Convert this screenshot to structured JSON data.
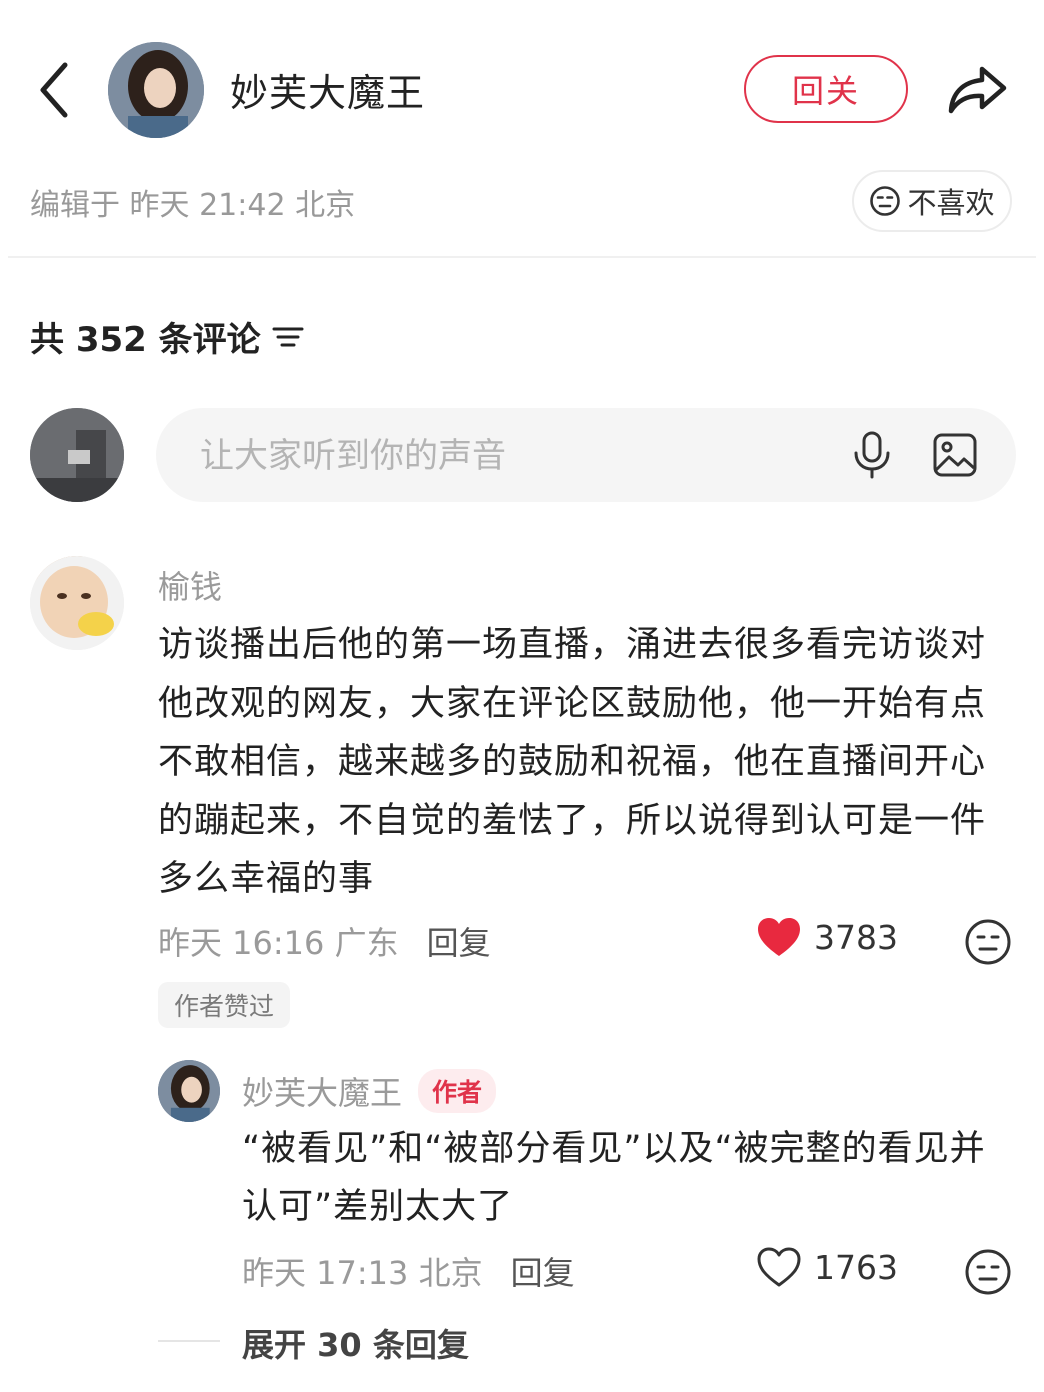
{
  "header": {
    "author_name": "妙芙大魔王",
    "follow_label": "回关"
  },
  "post_meta": {
    "edit_info": "编辑于 昨天 21:42 北京",
    "dislike_label": "不喜欢"
  },
  "comments_header": {
    "count_text": "共 352 条评论"
  },
  "comment_input": {
    "placeholder": "让大家听到你的声音"
  },
  "comments": [
    {
      "username": "榆钱",
      "text": "访谈播出后他的第一场直播，涌进去很多看完访谈对他改观的网友，大家在评论区鼓励他，他一开始有点不敢相信，越来越多的鼓励和祝福，他在直播间开心的蹦起来，不自觉的羞怯了，所以说得到认可是一件多么幸福的事",
      "time": "昨天 16:16",
      "location": "广东",
      "reply_label": "回复",
      "likes": "3783",
      "liked": true,
      "author_liked_label": "作者赞过",
      "replies": [
        {
          "username": "妙芙大魔王",
          "badge": "作者",
          "text": "“被看见”和“被部分看见”以及“被完整的看见并认可”差别太大了",
          "time": "昨天 17:13",
          "location": "北京",
          "reply_label": "回复",
          "likes": "1763",
          "liked": false
        }
      ],
      "expand_label": "展开 30 条回复"
    }
  ],
  "colors": {
    "accent": "#e0334a",
    "muted_text": "#9a9a9a",
    "input_bg": "#f5f5f5"
  },
  "icons": [
    "back-arrow-icon",
    "share-icon",
    "dislike-face-icon",
    "sort-icon",
    "microphone-icon",
    "image-icon",
    "heart-icon"
  ]
}
